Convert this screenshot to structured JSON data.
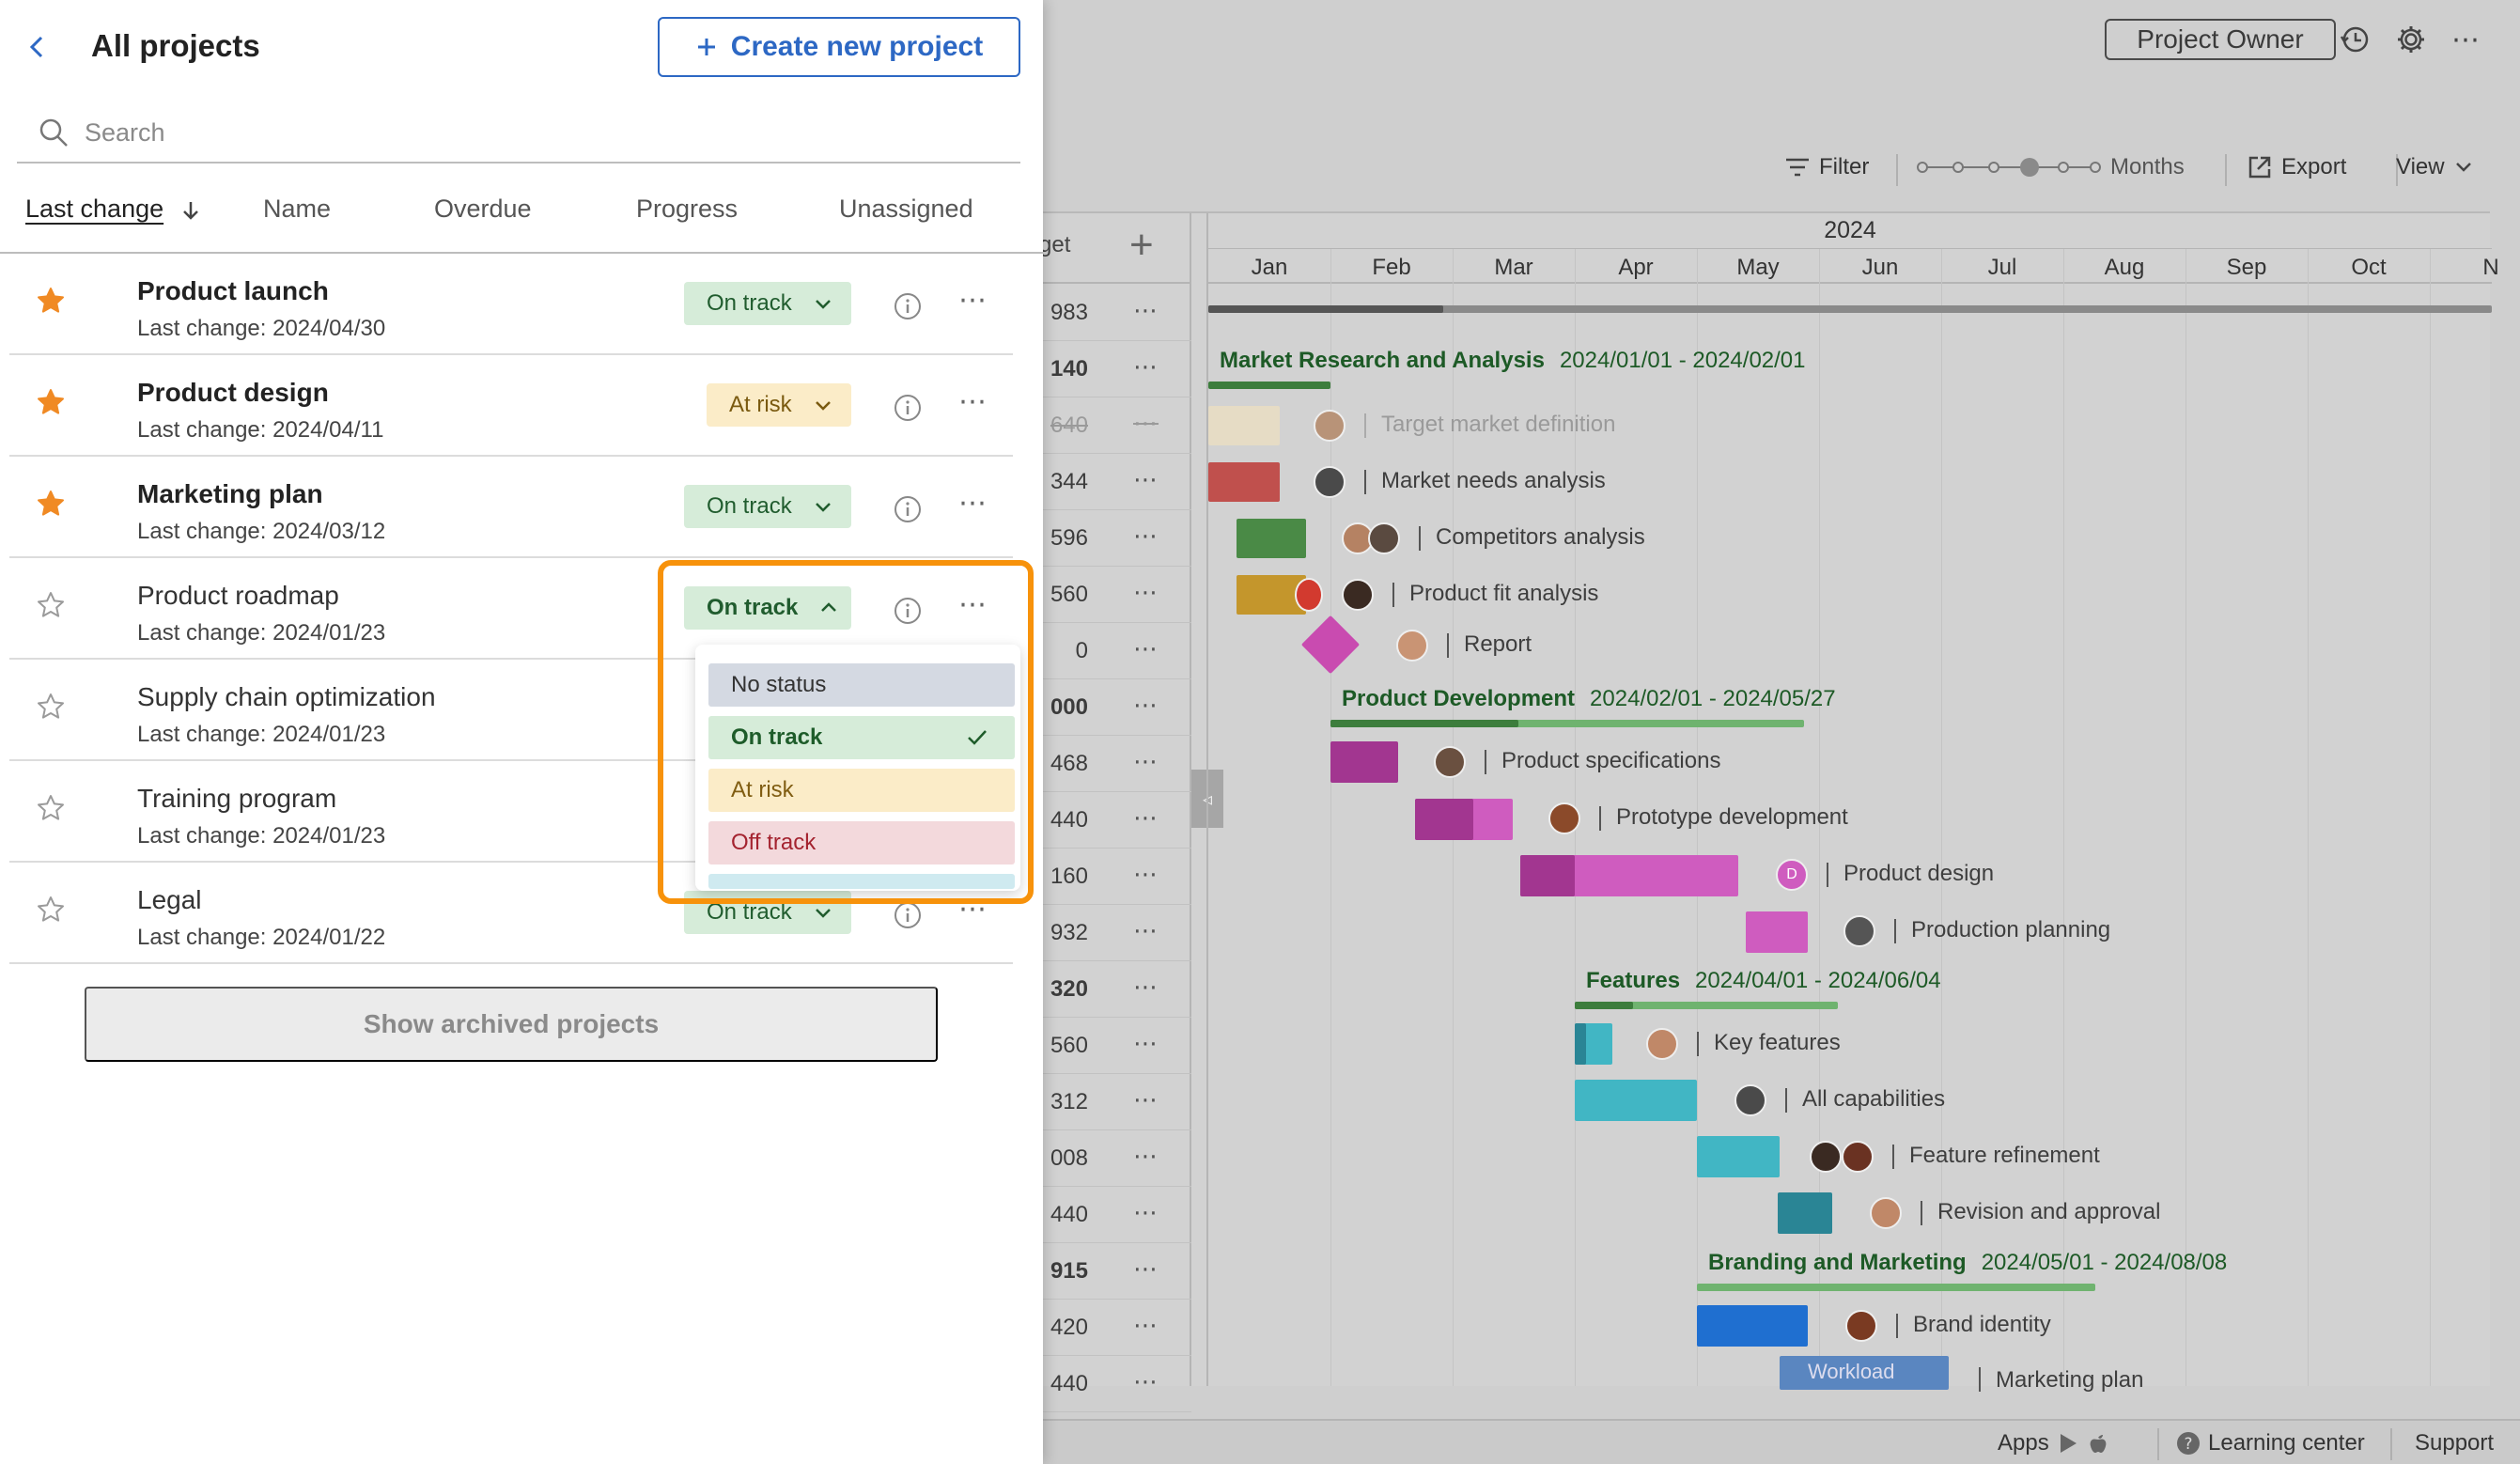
{
  "panel": {
    "title": "All projects",
    "create_button": "Create new project",
    "search_placeholder": "Search",
    "sort_options": [
      "Last change",
      "Name",
      "Overdue",
      "Progress",
      "Unassigned"
    ],
    "projects": [
      {
        "name": "Product launch",
        "last_change": "Last change: 2024/04/30",
        "status": "On track",
        "favorite": true
      },
      {
        "name": "Product design",
        "last_change": "Last change: 2024/04/11",
        "status": "At risk",
        "favorite": true
      },
      {
        "name": "Marketing plan",
        "last_change": "Last change: 2024/03/12",
        "status": "On track",
        "favorite": true
      },
      {
        "name": "Product roadmap",
        "last_change": "Last change: 2024/01/23",
        "status": "On track",
        "favorite": false
      },
      {
        "name": "Supply chain optimization",
        "last_change": "Last change: 2024/01/23",
        "status": "",
        "favorite": false
      },
      {
        "name": "Training program",
        "last_change": "Last change: 2024/01/23",
        "status": "",
        "favorite": false
      },
      {
        "name": "Legal",
        "last_change": "Last change: 2024/01/22",
        "status": "On track",
        "favorite": false
      }
    ],
    "show_archived": "Show archived projects",
    "status_dropdown": {
      "options": [
        "No status",
        "On track",
        "At risk",
        "Off track"
      ],
      "selected": "On track"
    }
  },
  "app": {
    "owner_button": "Project Owner",
    "toolbar": {
      "filter": "Filter",
      "zoom_level": "Months",
      "export": "Export",
      "view": "View"
    },
    "gantt": {
      "budget_header": "get",
      "year": "2024",
      "months": [
        "Jan",
        "Feb",
        "Mar",
        "Apr",
        "May",
        "Jun",
        "Jul",
        "Aug",
        "Sep",
        "Oct",
        "N"
      ],
      "left_values": [
        "983",
        "140",
        "640",
        "344",
        "596",
        "560",
        "0",
        "000",
        "468",
        "440",
        "160",
        "932",
        "320",
        "560",
        "312",
        "008",
        "440",
        "915",
        "420",
        "440"
      ],
      "groups": [
        {
          "name": "Market Research and Analysis",
          "dates": "2024/01/01 - 2024/02/01"
        },
        {
          "name": "Product Development",
          "dates": "2024/02/01 - 2024/05/27"
        },
        {
          "name": "Features",
          "dates": "2024/04/01 - 2024/06/04"
        },
        {
          "name": "Branding and Marketing",
          "dates": "2024/05/01 - 2024/08/08"
        }
      ],
      "tasks": [
        "Target market definition",
        "Market needs analysis",
        "Competitors analysis",
        "Product fit analysis",
        "Report",
        "Product specifications",
        "Prototype development",
        "Product design",
        "Production planning",
        "Key features",
        "All capabilities",
        "Feature refinement",
        "Revision and approval",
        "Brand identity",
        "Marketing plan"
      ],
      "avatar_initial": "D",
      "workload_label": "Workload"
    },
    "footer": {
      "apps": "Apps",
      "learning_center": "Learning center",
      "support": "Support"
    }
  }
}
